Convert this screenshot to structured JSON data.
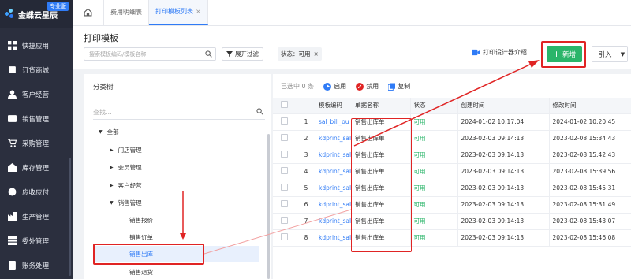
{
  "brand": {
    "name": "金蝶云星辰",
    "edition": "专业版"
  },
  "sidebar": {
    "items": [
      {
        "label": "快捷应用",
        "icon": "grid-icon"
      },
      {
        "label": "订货商城",
        "icon": "store-icon"
      },
      {
        "label": "客户经营",
        "icon": "person-icon"
      },
      {
        "label": "销售管理",
        "icon": "sales-icon"
      },
      {
        "label": "采购管理",
        "icon": "cart-icon"
      },
      {
        "label": "库存管理",
        "icon": "warehouse-icon"
      },
      {
        "label": "应收应付",
        "icon": "money-icon"
      },
      {
        "label": "生产管理",
        "icon": "factory-icon"
      },
      {
        "label": "委外管理",
        "icon": "outsource-icon"
      },
      {
        "label": "账务处理",
        "icon": "ledger-icon"
      }
    ]
  },
  "tabs": [
    {
      "label": "费用明细表",
      "active": false
    },
    {
      "label": "打印模板列表",
      "active": true,
      "close": "×"
    }
  ],
  "page": {
    "title": "打印模板",
    "search_placeholder": "搜索模板编码/模板名称",
    "filter_label": "展开过滤",
    "status_chip": "状态：可用",
    "chip_close": "×",
    "video_link": "打印设计器介绍",
    "new_label": "新增",
    "import_label": "引入"
  },
  "tree": {
    "title": "分类树",
    "search_placeholder": "查找...",
    "nodes": [
      {
        "label": "全部",
        "caret": "▼"
      },
      {
        "label": "门店管理",
        "caret": "▶"
      },
      {
        "label": "会员管理",
        "caret": "▶"
      },
      {
        "label": "客户经营",
        "caret": "▶"
      },
      {
        "label": "销售管理",
        "caret": "▼"
      },
      {
        "label": "销售报价",
        "caret": ""
      },
      {
        "label": "销售订单",
        "caret": ""
      },
      {
        "label": "销售出库",
        "caret": "",
        "selected": true
      },
      {
        "label": "销售退货",
        "caret": ""
      }
    ]
  },
  "toolbar": {
    "selected": "已选中 0 条",
    "enable": "启用",
    "disable": "禁用",
    "copy": "复制"
  },
  "table": {
    "headers": [
      "",
      "模板编码",
      "单据名称",
      "状态",
      "创建时间",
      "修改时间"
    ],
    "rows": [
      {
        "idx": "1",
        "code": "sal_bill_ou",
        "name": "销售出库单",
        "status": "可用",
        "created": "2024-01-02 10:17:04",
        "modified": "2024-01-02 10:20:45"
      },
      {
        "idx": "2",
        "code": "kdprint_sal",
        "name": "销售出库单",
        "status": "可用",
        "created": "2023-02-03 09:14:13",
        "modified": "2023-02-08 15:34:43"
      },
      {
        "idx": "3",
        "code": "kdprint_sal",
        "name": "销售出库单",
        "status": "可用",
        "created": "2023-02-03 09:14:13",
        "modified": "2023-02-08 15:42:43"
      },
      {
        "idx": "4",
        "code": "kdprint_sal",
        "name": "销售出库单",
        "status": "可用",
        "created": "2023-02-03 09:14:13",
        "modified": "2023-02-08 15:39:56"
      },
      {
        "idx": "5",
        "code": "kdprint_sal",
        "name": "销售出库单",
        "status": "可用",
        "created": "2023-02-03 09:14:13",
        "modified": "2023-02-08 15:45:31"
      },
      {
        "idx": "6",
        "code": "kdprint_sal",
        "name": "销售出库单",
        "status": "可用",
        "created": "2023-02-03 09:14:13",
        "modified": "2023-02-08 15:31:49"
      },
      {
        "idx": "7",
        "code": "kdprint_sal",
        "name": "销售出库单",
        "status": "可用",
        "created": "2023-02-03 09:14:13",
        "modified": "2023-02-08 15:43:07"
      },
      {
        "idx": "8",
        "code": "kdprint_sal",
        "name": "销售出库单",
        "status": "可用",
        "created": "2023-02-03 09:14:13",
        "modified": "2023-02-08 15:46:08"
      }
    ]
  },
  "colors": {
    "accent": "#2f7bf6",
    "success": "#2bb56a",
    "danger": "#e02424",
    "sidebar": "#2b2f3e"
  }
}
